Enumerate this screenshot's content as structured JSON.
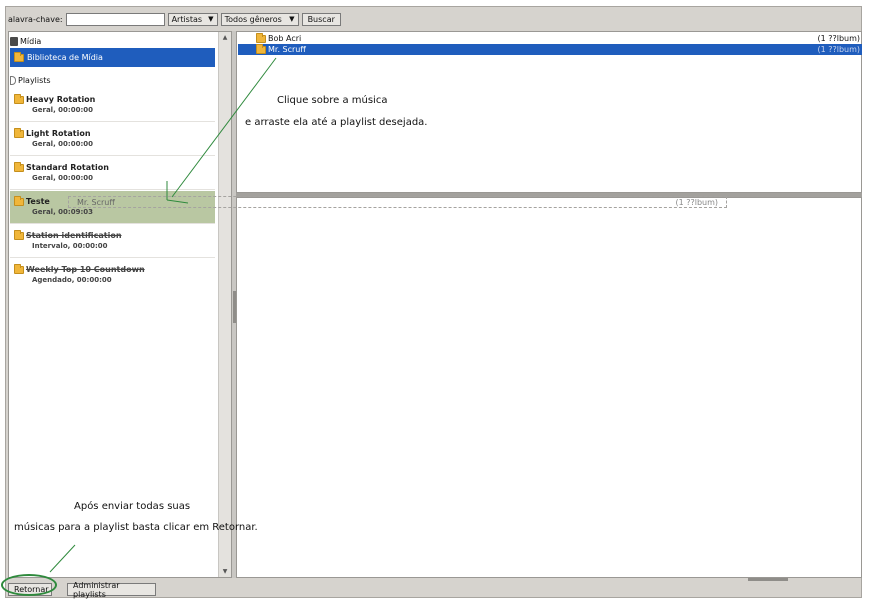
{
  "toolbar": {
    "keyword_label": "alavra-chave:",
    "keyword_value": "",
    "artists_select": "Artistas",
    "genre_select": "Todos gêneros",
    "search_button": "Buscar"
  },
  "left_panel": {
    "media_section": "Mídia",
    "library_item": "Biblioteca de Mídia",
    "playlists_section": "Playlists",
    "playlists": [
      {
        "name": "Heavy Rotation",
        "sub": "Geral, 00:00:00"
      },
      {
        "name": "Light Rotation",
        "sub": "Geral, 00:00:00"
      },
      {
        "name": "Standard Rotation",
        "sub": "Geral, 00:00:00"
      },
      {
        "name": "Teste",
        "sub": "Geral, 00:09:03"
      },
      {
        "name": "Station identification",
        "sub": "Intervalo, 00:00:00"
      },
      {
        "name": "Weekly Top 10 Countdown",
        "sub": "Agendado, 00:00:00"
      }
    ]
  },
  "artists": [
    {
      "name": "Bob Acri",
      "count": "(1 ??lbum)"
    },
    {
      "name": "Mr. Scruff",
      "count": "(1 ??lbum)"
    }
  ],
  "drag_ghost": {
    "name": "Mr. Scruff",
    "count": "(1 ??lbum)"
  },
  "bottom": {
    "return_button": "Retornar",
    "manage_button": "Administrar playlists"
  },
  "annotations": {
    "drag_line1": "Clique sobre a música",
    "drag_line2": "e arraste ela até a playlist desejada.",
    "return_line1": "Após enviar todas suas",
    "return_line2": "músicas para a playlist basta clicar em Retornar."
  },
  "colors": {
    "selection": "#1f5dbd",
    "drop_target": "#b9c7a2",
    "annotation_stroke": "#2f8a3d"
  }
}
